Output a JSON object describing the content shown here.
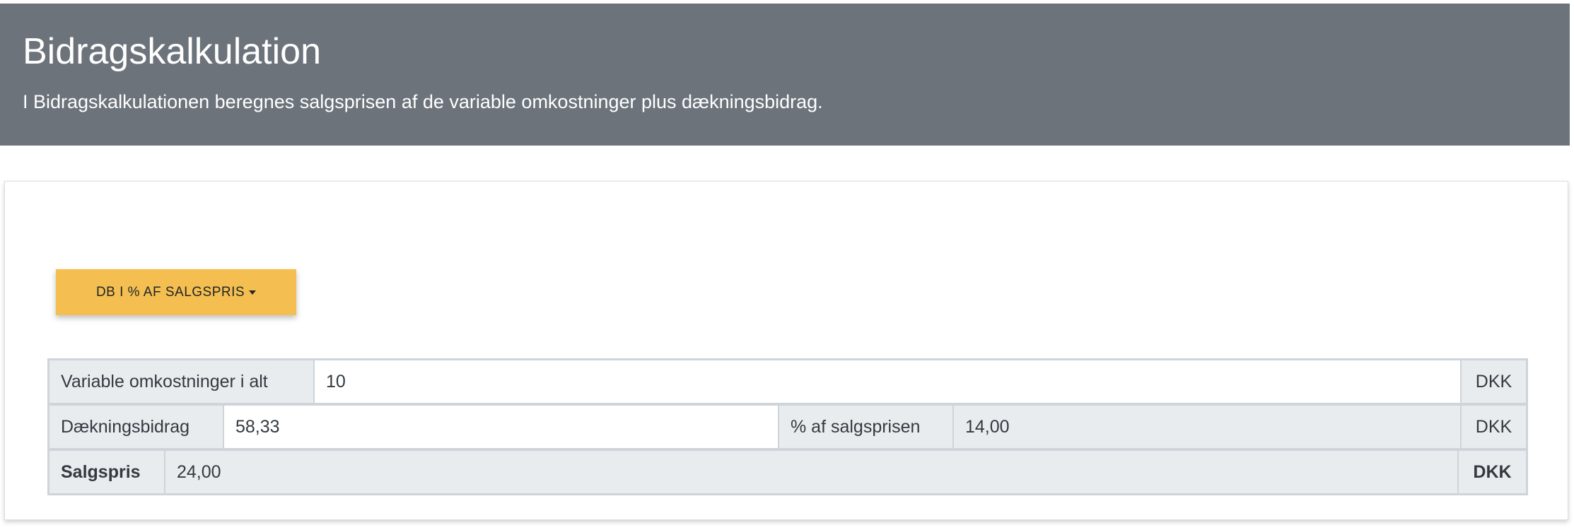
{
  "header": {
    "title": "Bidragskalkulation",
    "subtitle": "I Bidragskalkulationen beregnes salgsprisen af de variable omkostninger plus dækningsbidrag."
  },
  "mode_dropdown": {
    "label": "DB I % AF SALGSPRIS",
    "color": "#f4bf50"
  },
  "calc": {
    "variable_costs": {
      "label": "Variable omkostninger i alt",
      "value": "10",
      "unit": "DKK"
    },
    "contribution": {
      "label": "Dækningsbidrag",
      "value": "58,33",
      "percent_label": "% af salgsprisen",
      "result": "14,00",
      "unit": "DKK"
    },
    "sales_price": {
      "label": "Salgspris",
      "value": "24,00",
      "unit": "DKK"
    }
  }
}
